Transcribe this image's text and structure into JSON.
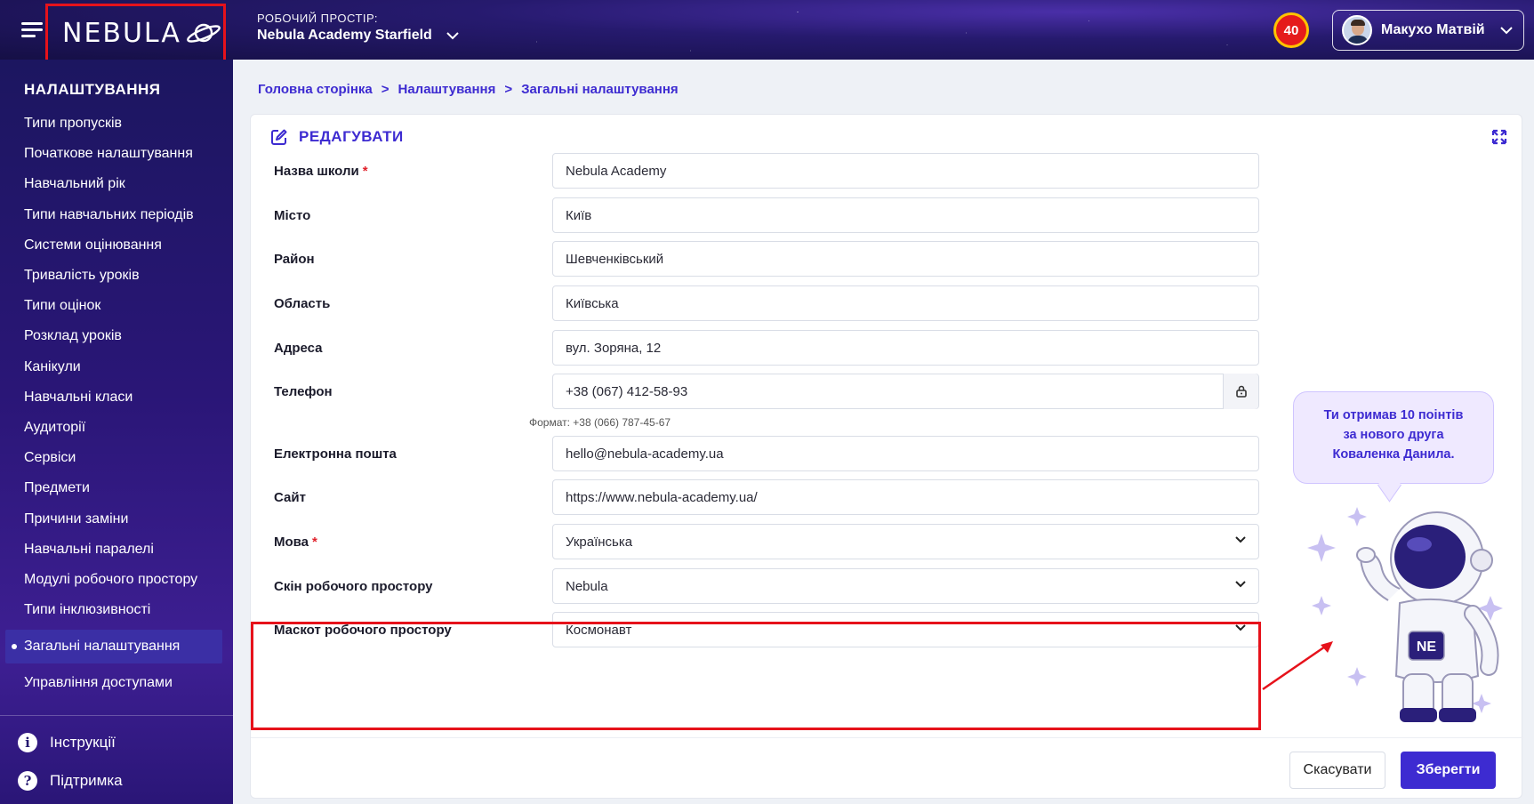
{
  "header": {
    "logo_text": "NEBULA",
    "workspace_label": "РОБОЧИЙ ПРОСТІР:",
    "workspace_name": "Nebula Academy Starfield",
    "points": "40",
    "user_name": "Макухо Матвій"
  },
  "sidebar": {
    "title": "НАЛАШТУВАННЯ",
    "items": [
      {
        "label": "Типи пропусків"
      },
      {
        "label": "Початкове налаштування"
      },
      {
        "label": "Навчальний рік"
      },
      {
        "label": "Типи навчальних періодів"
      },
      {
        "label": "Системи оцінювання"
      },
      {
        "label": "Тривалість уроків"
      },
      {
        "label": "Типи оцінок"
      },
      {
        "label": "Розклад уроків"
      },
      {
        "label": "Канікули"
      },
      {
        "label": "Навчальні класи"
      },
      {
        "label": "Аудиторії"
      },
      {
        "label": "Сервіси"
      },
      {
        "label": "Предмети"
      },
      {
        "label": "Причини заміни"
      },
      {
        "label": "Навчальні паралелі"
      },
      {
        "label": "Модулі робочого простору"
      },
      {
        "label": "Типи інклюзивності"
      },
      {
        "label": "Загальні налаштування",
        "active": true
      },
      {
        "label": "Управління доступами"
      }
    ],
    "footer": {
      "instructions": "Інструкції",
      "support": "Підтримка"
    }
  },
  "breadcrumb": {
    "home": "Головна сторінка",
    "settings": "Налаштування",
    "current": "Загальні налаштування",
    "separator": ">"
  },
  "form": {
    "title": "РЕДАГУВАТИ",
    "fields": {
      "school_name": {
        "label": "Назва школи",
        "required": "*",
        "value": "Nebula Academy"
      },
      "city": {
        "label": "Місто",
        "value": "Київ"
      },
      "district": {
        "label": "Район",
        "value": "Шевченківський"
      },
      "region": {
        "label": "Область",
        "value": "Київська"
      },
      "address": {
        "label": "Адреса",
        "value": "вул. Зоряна, 12"
      },
      "phone": {
        "label": "Телефон",
        "value": "+38 (067) 412-58-93",
        "hint": "Формат: +38 (066) 787-45-67"
      },
      "email": {
        "label": "Електронна пошта",
        "value": "hello@nebula-academy.ua"
      },
      "site": {
        "label": "Сайт",
        "value": "https://www.nebula-academy.ua/"
      },
      "language": {
        "label": "Мова",
        "required": "*",
        "value": "Українська"
      },
      "skin": {
        "label": "Скін робочого простору",
        "value": "Nebula"
      },
      "mascot": {
        "label": "Маскот робочого простору",
        "value": "Космонавт"
      }
    },
    "cancel_label": "Скасувати",
    "save_label": "Зберегти"
  },
  "mascot": {
    "message_line1": "Ти отримав 10 поінтів",
    "message_line2": "за нового друга",
    "message_line3": "Коваленка Данила.",
    "badge_text": "NE"
  },
  "colors": {
    "accent": "#3d2bd1",
    "highlight": "#e6121b",
    "sidebar": "#2a1677",
    "points_badge": "#e51b1b"
  }
}
